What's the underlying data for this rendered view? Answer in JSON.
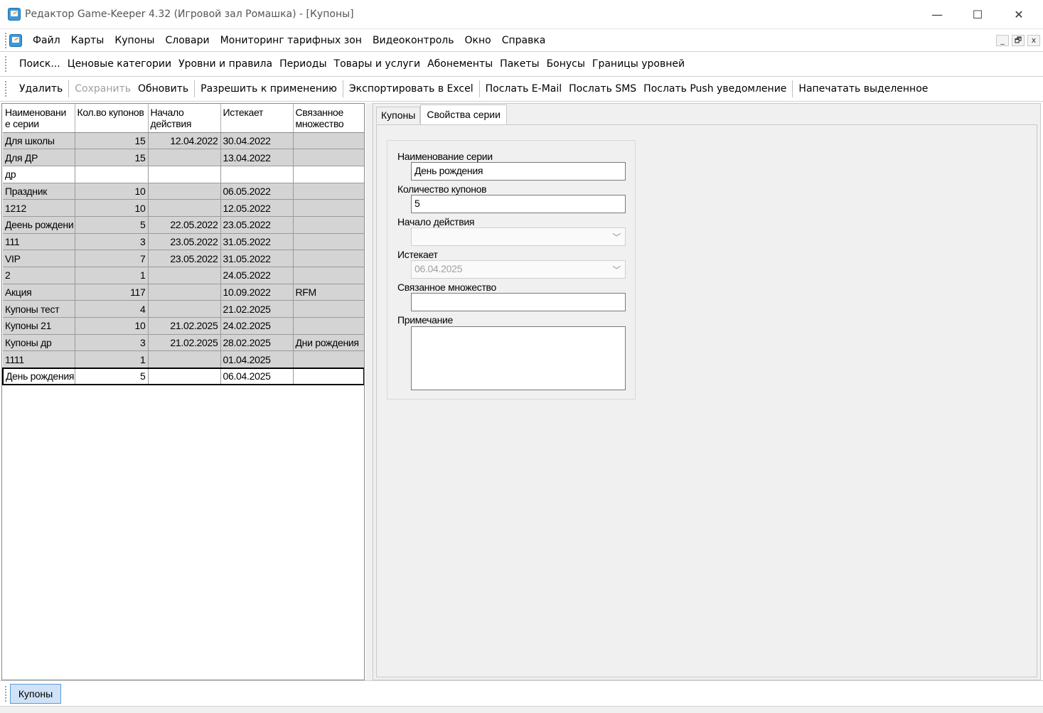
{
  "window": {
    "title": "Редактор Game-Keeper 4.32 (Игровой зал Ромашка) - [Купоны]",
    "minimize_glyph": "—",
    "maximize_glyph": "☐",
    "close_glyph": "✕"
  },
  "menu": {
    "items": [
      "Файл",
      "Карты",
      "Купоны",
      "Словари",
      "Мониторинг тарифных зон",
      "Видеоконтроль",
      "Окно",
      "Справка"
    ],
    "mdi_minimize": "_",
    "mdi_restore": "🗗",
    "mdi_close": "x"
  },
  "toolbar1": {
    "items": [
      "Поиск...",
      "Ценовые категории",
      "Уровни и правила",
      "Периоды",
      "Товары и услуги",
      "Абонементы",
      "Пакеты",
      "Бонусы",
      "Границы уровней"
    ]
  },
  "toolbar2": {
    "delete": "Удалить",
    "save": "Сохранить",
    "refresh": "Обновить",
    "allow": "Разрешить к применению",
    "export": "Экспортировать в Excel",
    "email": "Послать E-Mail",
    "sms": "Послать SMS",
    "push": "Послать Push уведомление",
    "print": "Напечатать выделенное"
  },
  "grid": {
    "headers": [
      "Наименовани е серии",
      "Кол.во купонов",
      "Начало действия",
      "Истекает",
      "Связанное множество"
    ],
    "rows": [
      [
        "Для школы",
        "15",
        "12.04.2022",
        "30.04.2022",
        ""
      ],
      [
        "Для ДР",
        "15",
        "",
        "13.04.2022",
        ""
      ],
      [
        "др",
        "",
        "",
        "",
        ""
      ],
      [
        "Праздник",
        "10",
        "",
        "06.05.2022",
        ""
      ],
      [
        "1212",
        "10",
        "",
        "12.05.2022",
        ""
      ],
      [
        "Деень рождени",
        "5",
        "22.05.2022",
        "23.05.2022",
        ""
      ],
      [
        "111",
        "3",
        "23.05.2022",
        "31.05.2022",
        ""
      ],
      [
        "VIP",
        "7",
        "23.05.2022",
        "31.05.2022",
        ""
      ],
      [
        "2",
        "1",
        "",
        "24.05.2022",
        ""
      ],
      [
        "Акция",
        "117",
        "",
        "10.09.2022",
        "RFM"
      ],
      [
        "Купоны тест",
        "4",
        "",
        "21.02.2025",
        ""
      ],
      [
        "Купоны 21",
        "10",
        "21.02.2025",
        "24.02.2025",
        ""
      ],
      [
        "Купоны др",
        "3",
        "21.02.2025",
        "28.02.2025",
        "Дни рождения"
      ],
      [
        "1111",
        "1",
        "",
        "01.04.2025",
        ""
      ],
      [
        "День рождения",
        "5",
        "",
        "06.04.2025",
        ""
      ]
    ]
  },
  "tabs": {
    "coupons": "Купоны",
    "properties": "Свойства серии"
  },
  "form": {
    "name_label": "Наименование серии",
    "name_value": "День рождения",
    "count_label": "Количество купонов",
    "count_value": "5",
    "start_label": "Начало действия",
    "start_value": "",
    "expires_label": "Истекает",
    "expires_value": "06.04.2025",
    "set_label": "Связанное множество",
    "set_value": "",
    "note_label": "Примечание",
    "note_value": ""
  },
  "bottom": {
    "window_tab": "Купоны"
  },
  "colors": {
    "grid_row": "#d4d4d4",
    "panel_bg": "#f0f0f0",
    "active_window_tab": "#cfe2f7"
  }
}
